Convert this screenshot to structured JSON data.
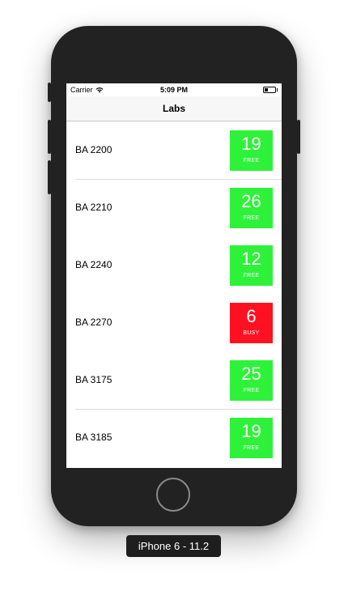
{
  "status_bar": {
    "carrier": "Carrier",
    "wifi_icon": "wifi-icon",
    "time": "5:09 PM",
    "battery_icon": "battery-icon",
    "battery_level": 0.35
  },
  "nav": {
    "title": "Labs"
  },
  "colors": {
    "free": "#2ef23a",
    "busy": "#ff1122"
  },
  "labs": [
    {
      "name": "BA 2200",
      "count": "19",
      "status": "FREE"
    },
    {
      "name": "BA 2210",
      "count": "26",
      "status": "FREE"
    },
    {
      "name": "BA 2240",
      "count": "12",
      "status": "FREE"
    },
    {
      "name": "BA 2270",
      "count": "6",
      "status": "BUSY"
    },
    {
      "name": "BA 3175",
      "count": "25",
      "status": "FREE"
    },
    {
      "name": "BA 3185",
      "count": "19",
      "status": "FREE"
    }
  ],
  "device_label": "iPhone 6 - 11.2"
}
